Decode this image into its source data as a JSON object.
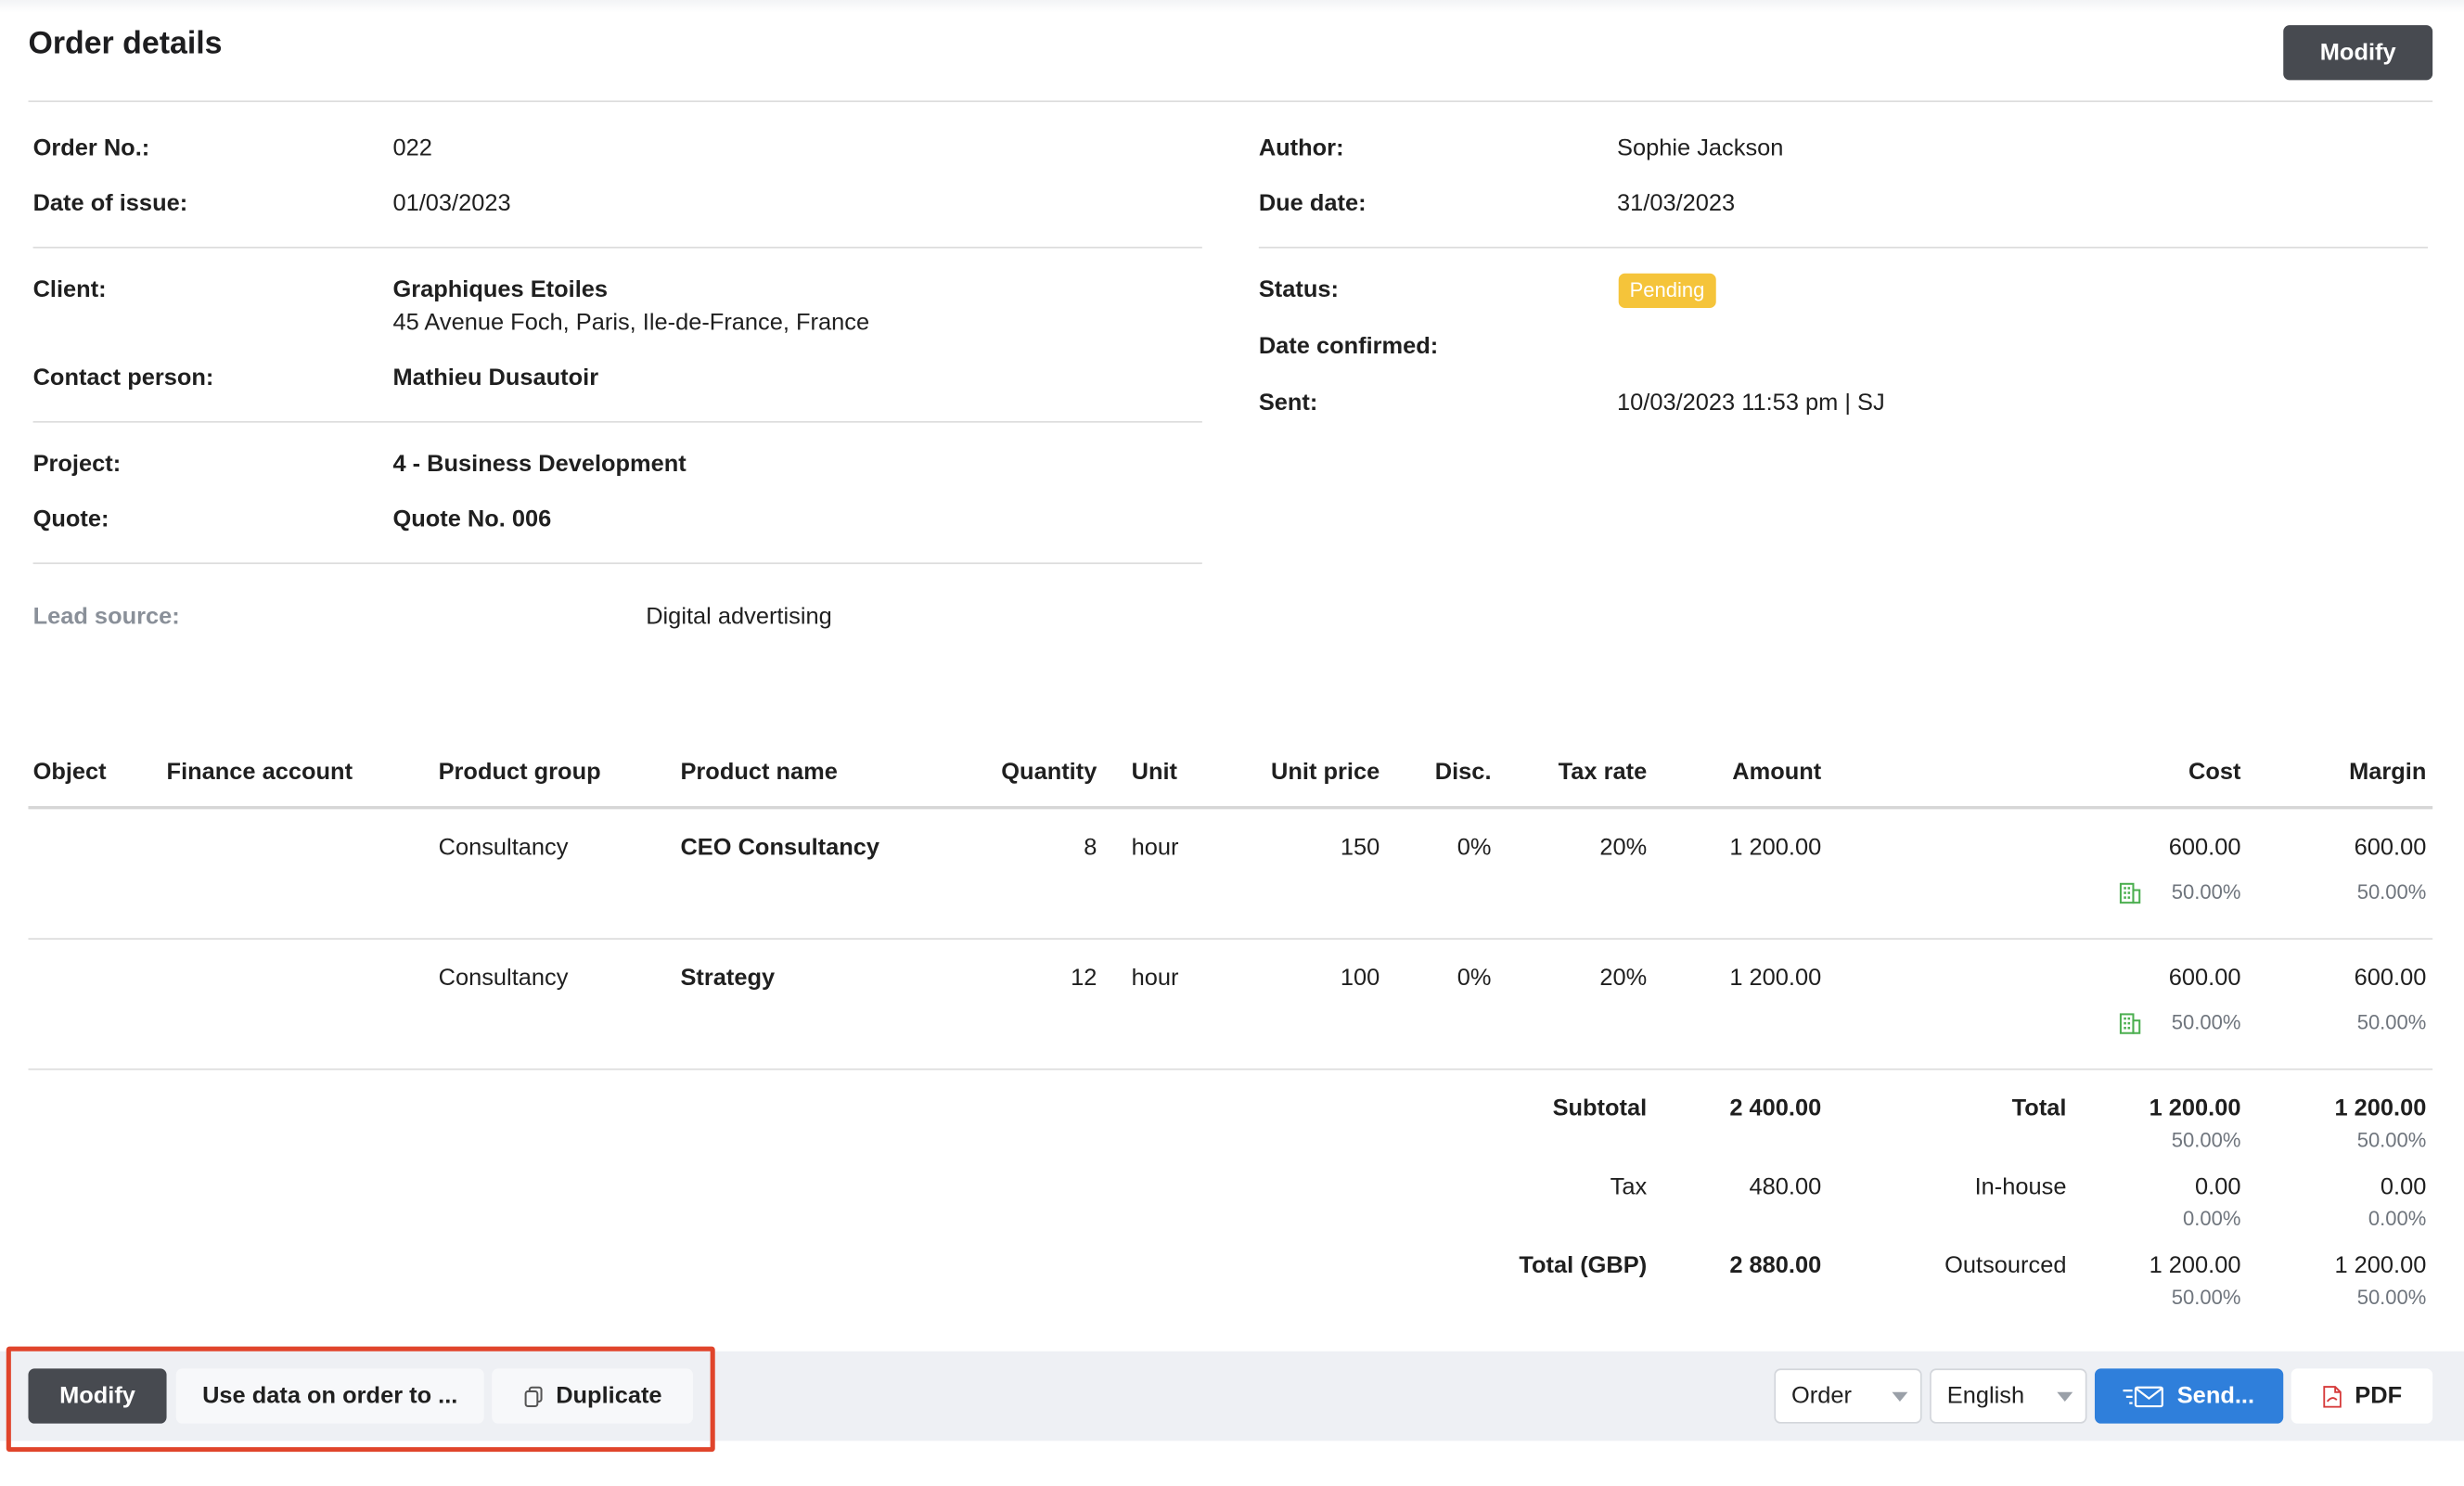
{
  "header": {
    "title": "Order details",
    "modify_label": "Modify"
  },
  "details_left": {
    "order_no_label": "Order No.:",
    "order_no": "022",
    "date_issue_label": "Date of issue:",
    "date_issue": "01/03/2023",
    "client_label": "Client:",
    "client_name": "Graphiques Etoiles",
    "client_address": "45 Avenue Foch, Paris, Ile-de-France, France",
    "contact_label": "Contact person:",
    "contact": "Mathieu Dusautoir",
    "project_label": "Project:",
    "project": "4 - Business Development",
    "quote_label": "Quote:",
    "quote": "Quote No. 006",
    "lead_label": "Lead source:",
    "lead": "Digital advertising"
  },
  "details_right": {
    "author_label": "Author:",
    "author": "Sophie Jackson",
    "due_label": "Due date:",
    "due": "31/03/2023",
    "status_label": "Status:",
    "status": "Pending",
    "status_color": "#f5c43a",
    "confirmed_label": "Date confirmed:",
    "sent_label": "Sent:",
    "sent": "10/03/2023 11:53 pm | SJ"
  },
  "table": {
    "headers": [
      "Object",
      "Finance account",
      "Product group",
      "Product name",
      "Quantity",
      "Unit",
      "Unit price",
      "Disc.",
      "Tax rate",
      "Amount",
      "Cost",
      "Margin"
    ],
    "rows": [
      {
        "group": "Consultancy",
        "name": "CEO Consultancy",
        "qty": "8",
        "unit": "hour",
        "price": "150",
        "disc": "0%",
        "tax": "20%",
        "amount": "1 200.00",
        "cost": "600.00",
        "cost_pct": "50.00%",
        "margin": "600.00",
        "margin_pct": "50.00%",
        "cost_icon": "building-icon"
      },
      {
        "group": "Consultancy",
        "name": "Strategy",
        "qty": "12",
        "unit": "hour",
        "price": "100",
        "disc": "0%",
        "tax": "20%",
        "amount": "1 200.00",
        "cost": "600.00",
        "cost_pct": "50.00%",
        "margin": "600.00",
        "margin_pct": "50.00%",
        "cost_icon": "building-icon"
      }
    ]
  },
  "totals": {
    "subtotal_label": "Subtotal",
    "subtotal": "2 400.00",
    "tax_label": "Tax",
    "tax": "480.00",
    "total_label": "Total (GBP)",
    "total": "2 880.00",
    "cost_rows": [
      {
        "label": "Total",
        "cost": "1 200.00",
        "cost_pct": "50.00%",
        "margin": "1 200.00",
        "margin_pct": "50.00%"
      },
      {
        "label": "In-house",
        "cost": "0.00",
        "cost_pct": "0.00%",
        "margin": "0.00",
        "margin_pct": "0.00%"
      },
      {
        "label": "Outsourced",
        "cost": "1 200.00",
        "cost_pct": "50.00%",
        "margin": "1 200.00",
        "margin_pct": "50.00%"
      }
    ]
  },
  "footer": {
    "modify_label": "Modify",
    "use_data_label": "Use data on order to ...",
    "duplicate_label": "Duplicate",
    "doc_type": "Order",
    "language": "English",
    "send_label": "Send...",
    "pdf_label": "PDF"
  },
  "colors": {
    "accent_blue": "#2f7fdb",
    "dark_button": "#474a50",
    "highlight": "#e0442b",
    "pdf_red": "#d63a3a",
    "building_green": "#4caf50"
  }
}
